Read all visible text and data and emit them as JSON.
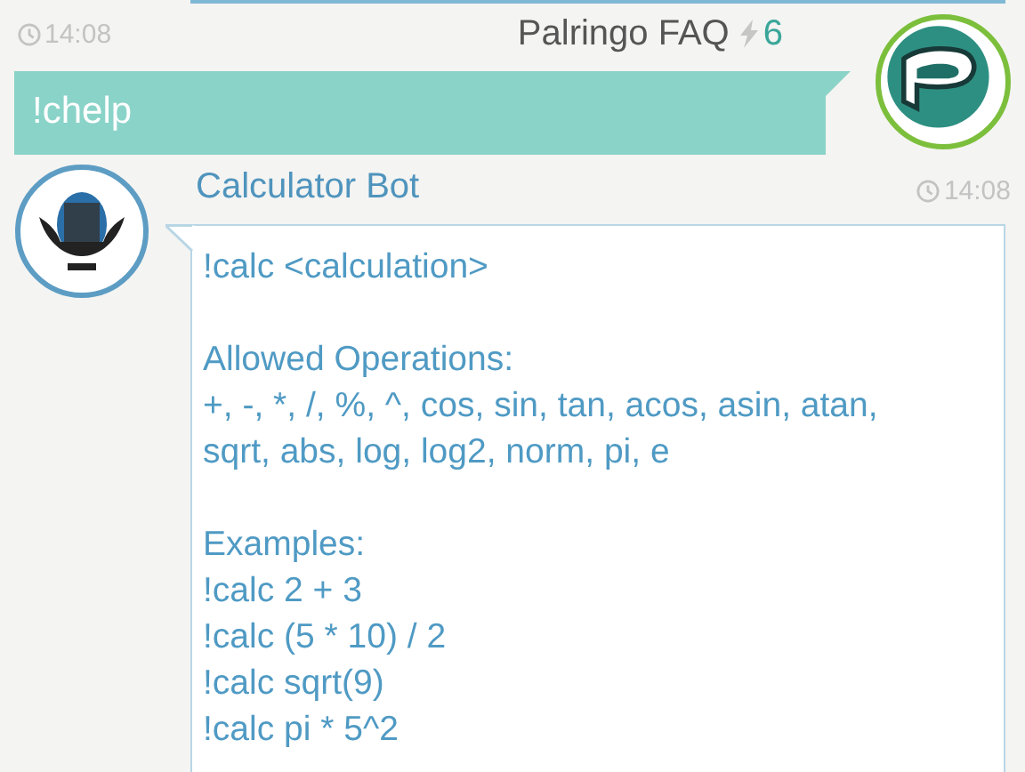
{
  "messages": [
    {
      "kind": "outgoing",
      "time": "14:08",
      "sender": "Palringo FAQ",
      "reputation": "6",
      "text": "!chelp"
    },
    {
      "kind": "incoming",
      "time": "14:08",
      "sender": "Calculator Bot",
      "blocks": [
        [
          "!calc <calculation>"
        ],
        [
          "Allowed Operations:",
          "+, -, *, /, %, ^, cos, sin, tan, acos, asin, atan,",
          "sqrt, abs, log, log2, norm, pi, e"
        ],
        [
          "Examples:",
          "!calc 2 + 3",
          "!calc (5 * 10) / 2",
          "!calc sqrt(9)",
          "!calc pi * 5^2"
        ]
      ]
    }
  ]
}
